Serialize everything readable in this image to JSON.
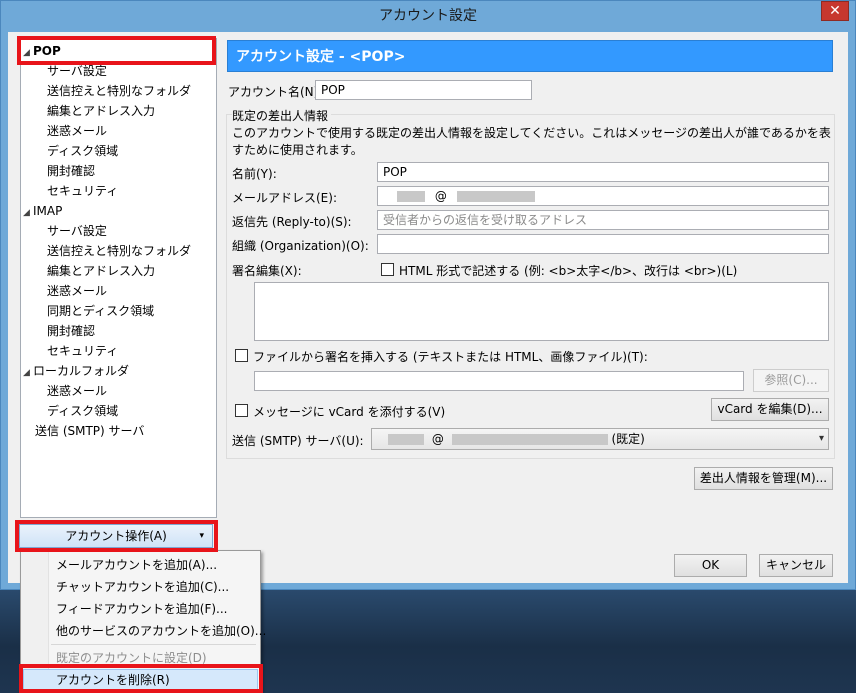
{
  "window": {
    "title": "アカウント設定",
    "close_glyph": "✕"
  },
  "tree": {
    "items": [
      {
        "label": "POP"
      },
      {
        "label": "サーバ設定"
      },
      {
        "label": "送信控えと特別なフォルダ"
      },
      {
        "label": "編集とアドレス入力"
      },
      {
        "label": "迷惑メール"
      },
      {
        "label": "ディスク領域"
      },
      {
        "label": "開封確認"
      },
      {
        "label": "セキュリティ"
      },
      {
        "label": "IMAP"
      },
      {
        "label": "サーバ設定"
      },
      {
        "label": "送信控えと特別なフォルダ"
      },
      {
        "label": "編集とアドレス入力"
      },
      {
        "label": "迷惑メール"
      },
      {
        "label": "同期とディスク領域"
      },
      {
        "label": "開封確認"
      },
      {
        "label": "セキュリティ"
      },
      {
        "label": "ローカルフォルダ"
      },
      {
        "label": "迷惑メール"
      },
      {
        "label": "ディスク領域"
      },
      {
        "label": "送信 (SMTP) サーバ"
      }
    ],
    "expander_glyph": "◢"
  },
  "panel": {
    "header": "アカウント設定 - <POP>",
    "account_name_label": "アカウント名(N):",
    "account_name_value": "POP",
    "group_title": "既定の差出人情報",
    "description": "このアカウントで使用する既定の差出人情報を設定してください。これはメッセージの差出人が誰であるかを表すために使用されます。",
    "name_label": "名前(Y):",
    "name_value": "POP",
    "email_label": "メールアドレス(E):",
    "email_at": "@",
    "reply_label": "返信先 (Reply-to)(S):",
    "reply_placeholder": "受信者からの返信を受け取るアドレス",
    "org_label": "組織 (Organization)(O):",
    "sig_label": "署名編集(X):",
    "html_label": "HTML 形式で記述する (例: <b>太字</b>、改行は <br>)(L)",
    "file_sig_label": "ファイルから署名を挿入する (テキストまたは HTML、画像ファイル)(T):",
    "browse_button": "参照(C)...",
    "vcard_label": "メッセージに vCard を添付する(V)",
    "vcard_edit_button": "vCard を編集(D)...",
    "smtp_label": "送信 (SMTP) サーバ(U):",
    "smtp_at": "@",
    "smtp_default": "(既定)",
    "manage_identities_button": "差出人情報を管理(M)...",
    "ok_button": "OK",
    "cancel_button": "キャンセル"
  },
  "account_ops": {
    "button": "アカウント操作(A)",
    "arrow": "▾",
    "menu": [
      {
        "label": "メールアカウントを追加(A)...",
        "enabled": true
      },
      {
        "label": "チャットアカウントを追加(C)...",
        "enabled": true
      },
      {
        "label": "フィードアカウントを追加(F)...",
        "enabled": true
      },
      {
        "label": "他のサービスのアカウントを追加(O)...",
        "enabled": true
      },
      {
        "label": "既定のアカウントに設定(D)",
        "enabled": false
      },
      {
        "label": "アカウントを削除(R)",
        "enabled": true
      }
    ]
  },
  "colors": {
    "highlight": "#e8141a",
    "header_blue": "#3399ff"
  }
}
